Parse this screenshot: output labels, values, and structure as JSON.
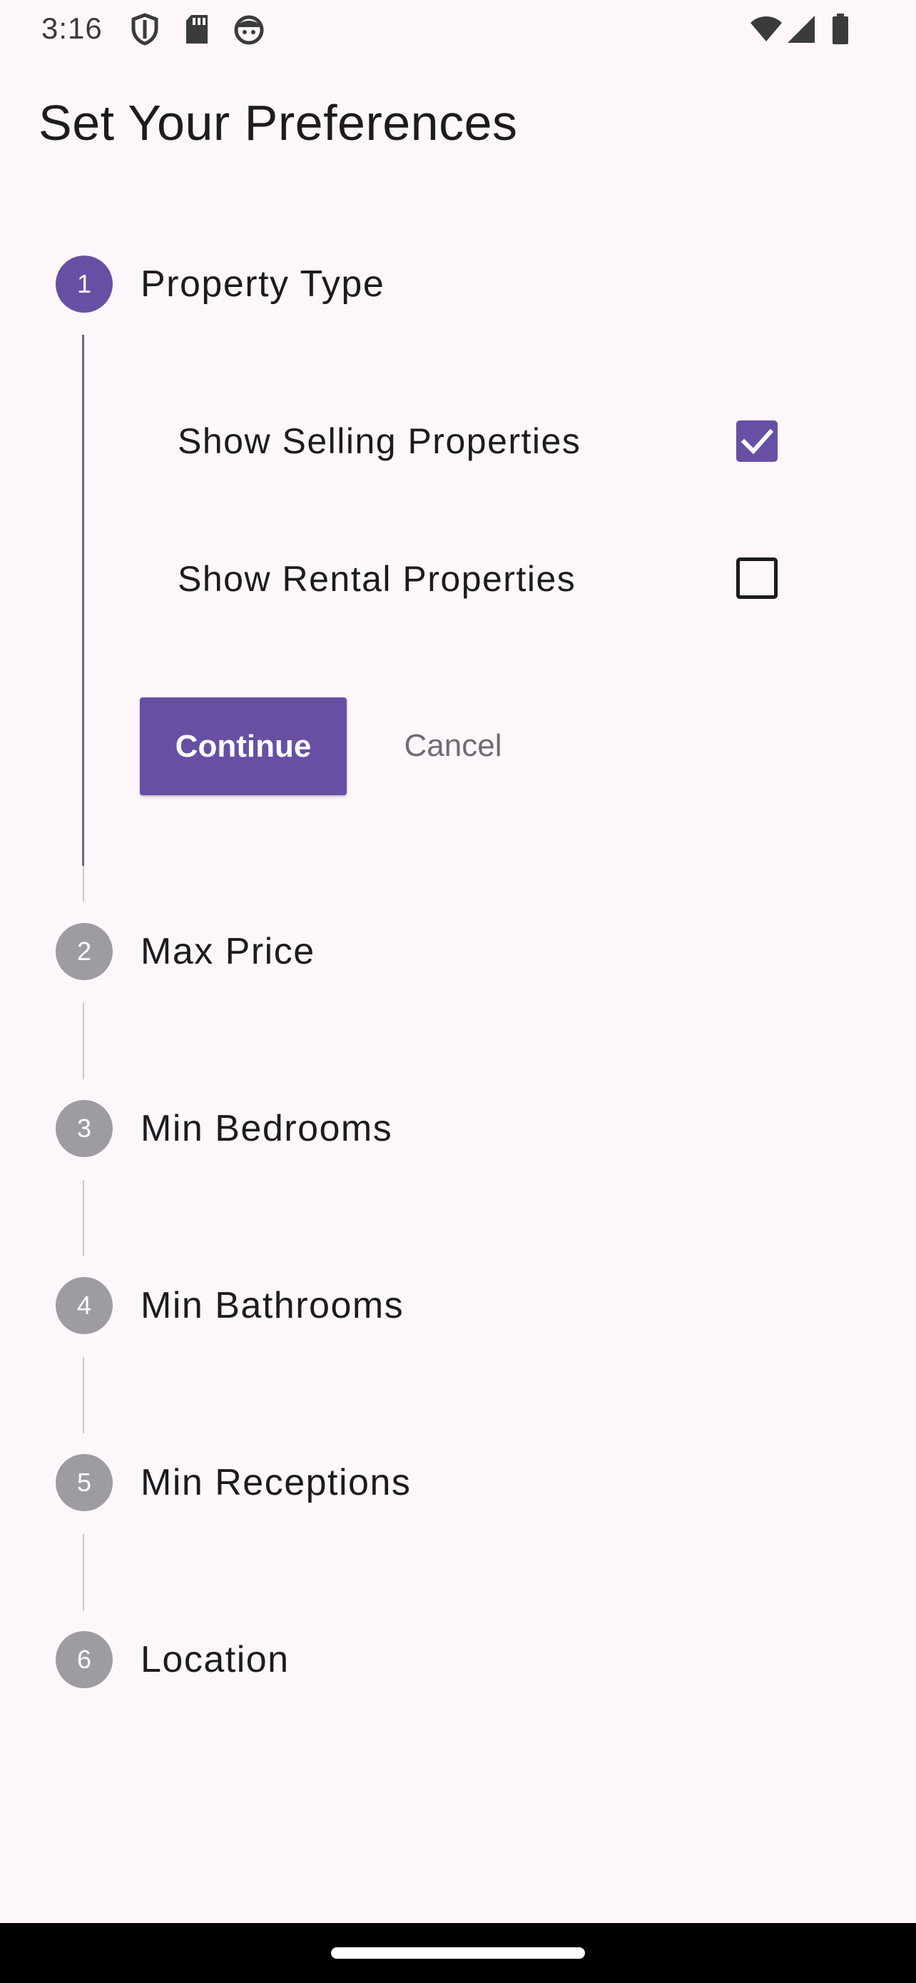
{
  "status_bar": {
    "time": "3:16",
    "left_icons": [
      "shield-icon",
      "sd-card-icon",
      "face-icon"
    ],
    "right_icons": [
      "wifi-icon",
      "signal-icon",
      "battery-icon"
    ]
  },
  "page": {
    "title": "Set Your Preferences"
  },
  "steps": [
    {
      "number": "1",
      "title": "Property Type",
      "active": true,
      "options": [
        {
          "label": "Show Selling Properties",
          "checked": true
        },
        {
          "label": "Show Rental Properties",
          "checked": false
        }
      ],
      "continue_label": "Continue",
      "cancel_label": "Cancel"
    },
    {
      "number": "2",
      "title": "Max Price",
      "active": false
    },
    {
      "number": "3",
      "title": "Min Bedrooms",
      "active": false
    },
    {
      "number": "4",
      "title": "Min Bathrooms",
      "active": false
    },
    {
      "number": "5",
      "title": "Min Receptions",
      "active": false
    },
    {
      "number": "6",
      "title": "Location",
      "active": false
    }
  ],
  "colors": {
    "accent": "#6750a4",
    "inactive_step": "#9e9ba2",
    "background": "#fdf7fc"
  }
}
